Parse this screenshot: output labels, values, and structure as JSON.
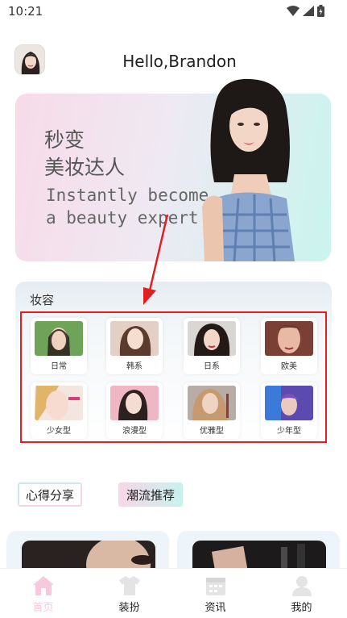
{
  "status_bar": {
    "time": "10:21"
  },
  "header": {
    "greeting": "Hello,Brandon"
  },
  "banner": {
    "title_line1": "秒变",
    "title_line2": "美妆达人",
    "subtitle_line1": "Instantly become",
    "subtitle_line2": "a beauty expert"
  },
  "makeup": {
    "title": "妆容",
    "styles": [
      "日常",
      "韩系",
      "日系",
      "欧美",
      "少女型",
      "浪漫型",
      "优雅型",
      "少年型"
    ]
  },
  "tags": {
    "experience": "心得分享",
    "trend": "潮流推荐"
  },
  "tabbar": {
    "home": "首页",
    "dress": "装扮",
    "news": "资讯",
    "mine": "我的"
  },
  "colors": {
    "accent_pink": "#f8c9dc",
    "accent_mint": "#c9f2ec",
    "highlight_red": "#e02020"
  }
}
